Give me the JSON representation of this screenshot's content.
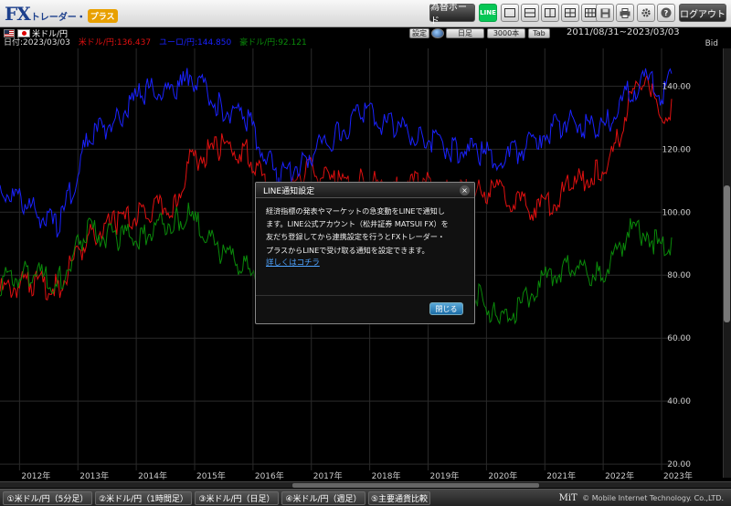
{
  "app": {
    "logo_fx": "FX",
    "logo_sub": "トレーダー・",
    "logo_badge": "プラス"
  },
  "toolbar": {
    "board_label": "為替ボード",
    "line_label": "LINE",
    "logout_label": "ログアウト"
  },
  "chart_controls": {
    "pair_label": "米ドル/円",
    "settings_label": "設定",
    "period_label": "日足",
    "count_label": "3000本",
    "tab_label": "Tab",
    "range_text": "2011/08/31~2023/03/03"
  },
  "info_line": {
    "date": "日付:2023/03/03",
    "usd": "米ドル/円:136.437",
    "eur": "ユーロ/円:144.850",
    "aud": "豪ドル/円:92.121"
  },
  "bid_label": "Bid",
  "dialog": {
    "title": "LINE通知設定",
    "close_glyph": "×",
    "lines": [
      "経済指標の発表やマーケットの急変動をLINEで通知し",
      "ます。LINE公式アカウント（松井証券 MATSUI FX）を",
      "友だち登録してから連携設定を行うとFXトレーダー・",
      "プラスからLINEで受け取る通知を設定できます。"
    ],
    "link_label": "詳しくはコチラ",
    "close_button": "閉じる"
  },
  "bottom_tabs": [
    "①米ドル/円（5分足）",
    "②米ドル/円（1時間足）",
    "③米ドル/円（日足）",
    "④米ドル/円（週足）",
    "⑤主要通貨比較"
  ],
  "copyright": "© Mobile Internet Technology. Co.,LTD.",
  "copyright_mark": "MiT",
  "colors": {
    "usd": "#e01010",
    "eur": "#1a22ff",
    "aud": "#0a8a0a",
    "grid": "#2a2a2a"
  },
  "chart_data": {
    "type": "line",
    "x": [
      "2011/08/31",
      "2012/03",
      "2012/09",
      "2013/03",
      "2013/09",
      "2014/03",
      "2014/09",
      "2014/12",
      "2015/06",
      "2015/12",
      "2016/06",
      "2016/12",
      "2017/06",
      "2017/12",
      "2018/06",
      "2018/12",
      "2019/06",
      "2019/12",
      "2020/04",
      "2020/12",
      "2021/06",
      "2021/12",
      "2022/03",
      "2022/06",
      "2022/10",
      "2023/01",
      "2023/03/03"
    ],
    "x_ticks": [
      "2012年",
      "2013年",
      "2014年",
      "2015年",
      "2016年",
      "2017年",
      "2018年",
      "2019年",
      "2020年",
      "2021年",
      "2022年",
      "2023年"
    ],
    "y_ticks": [
      "20.00",
      "40.00",
      "60.00",
      "80.00",
      "100.00",
      "120.00",
      "140.00"
    ],
    "ylim": [
      18,
      152
    ],
    "series": [
      {
        "name": "米ドル/円",
        "color": "#e01010",
        "values": [
          77,
          80,
          78,
          94,
          99,
          102,
          105,
          118,
          123,
          121,
          103,
          116,
          111,
          112,
          110,
          111,
          108,
          109,
          108,
          103,
          110,
          115,
          120,
          136,
          148,
          130,
          136
        ]
      },
      {
        "name": "ユーロ/円",
        "color": "#1a22ff",
        "values": [
          110,
          104,
          97,
          125,
          132,
          141,
          139,
          146,
          136,
          132,
          113,
          120,
          127,
          134,
          129,
          126,
          122,
          121,
          118,
          126,
          132,
          128,
          132,
          140,
          144,
          140,
          144
        ]
      },
      {
        "name": "豪ドル/円",
        "color": "#0a8a0a",
        "values": [
          80,
          83,
          80,
          96,
          94,
          95,
          100,
          101,
          90,
          85,
          78,
          85,
          86,
          88,
          83,
          80,
          76,
          76,
          66,
          80,
          85,
          82,
          86,
          96,
          96,
          90,
          92
        ]
      }
    ],
    "grid": true
  }
}
